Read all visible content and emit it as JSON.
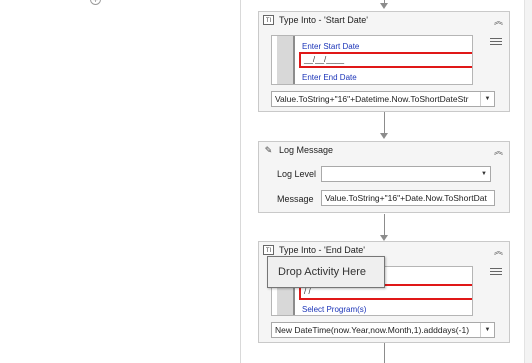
{
  "left_pane": {
    "add_icon": "plus-circle-icon"
  },
  "activities": {
    "type_into_start": {
      "title": "Type Into - 'Start Date'",
      "screen_label_top": "Enter Start Date",
      "field_value": "__/__/____",
      "screen_label_bottom": "Enter End Date",
      "expression": "Value.ToString+\"16\"+Datetime.Now.ToShortDateStr"
    },
    "log_message": {
      "title": "Log Message",
      "log_level_label": "Log Level",
      "log_level_value": "",
      "message_label": "Message",
      "message_value": "Value.ToString+\"16\"+Date.Now.ToShortDat"
    },
    "type_into_end": {
      "title": "Type Into - 'End Date'",
      "field_value": "/ /",
      "screen_label_bottom": "Select Program(s)",
      "expression": "New DateTime(now.Year,now.Month,1).adddays(-1)"
    }
  },
  "tooltip": {
    "text": "Drop Activity Here"
  },
  "colors": {
    "highlight": "#e01818",
    "label_blue": "#1b34b8"
  }
}
